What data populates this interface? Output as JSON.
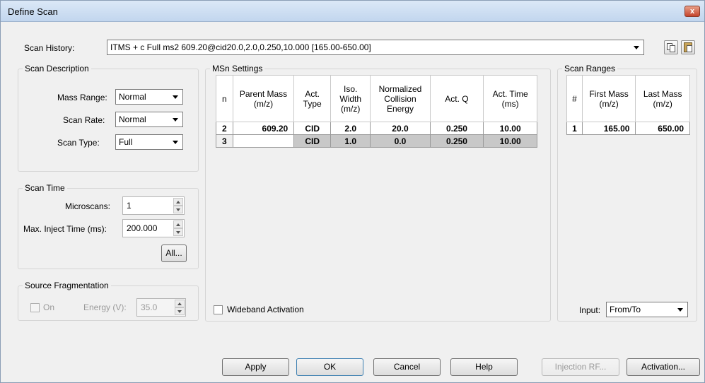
{
  "window": {
    "title": "Define Scan",
    "close": "x"
  },
  "history": {
    "label": "Scan History:",
    "value": "ITMS + c Full ms2 609.20@cid20.0,2.0,0.250,10.000 [165.00-650.00]",
    "copy_icon": "copy-icon",
    "paste_icon": "paste-icon"
  },
  "scan_description": {
    "title": "Scan Description",
    "mass_range_label": "Mass Range:",
    "mass_range_value": "Normal",
    "scan_rate_label": "Scan Rate:",
    "scan_rate_value": "Normal",
    "scan_type_label": "Scan Type:",
    "scan_type_value": "Full"
  },
  "scan_time": {
    "title": "Scan Time",
    "microscans_label": "Microscans:",
    "microscans_value": "1",
    "inject_label": "Max. Inject Time (ms):",
    "inject_value": "200.000",
    "all_button": "All..."
  },
  "source_frag": {
    "title": "Source Fragmentation",
    "on_label": "On",
    "energy_label": "Energy (V):",
    "energy_value": "35.0"
  },
  "msn": {
    "title": "MSn Settings",
    "headers": [
      "n",
      "Parent Mass (m/z)",
      "Act. Type",
      "Iso. Width (m/z)",
      "Normalized Collision Energy",
      "Act. Q",
      "Act. Time (ms)"
    ],
    "rows": [
      [
        "2",
        "609.20",
        "CID",
        "2.0",
        "20.0",
        "0.250",
        "10.00"
      ],
      [
        "3",
        "",
        "CID",
        "1.0",
        "0.0",
        "0.250",
        "10.00"
      ]
    ],
    "wideband_label": "Wideband Activation"
  },
  "ranges": {
    "title": "Scan Ranges",
    "headers": [
      "#",
      "First Mass (m/z)",
      "Last Mass (m/z)"
    ],
    "rows": [
      [
        "1",
        "165.00",
        "650.00"
      ]
    ],
    "input_label": "Input:",
    "input_value": "From/To"
  },
  "buttons": {
    "apply": "Apply",
    "ok": "OK",
    "cancel": "Cancel",
    "help": "Help",
    "injection": "Injection RF...",
    "activation": "Activation..."
  }
}
